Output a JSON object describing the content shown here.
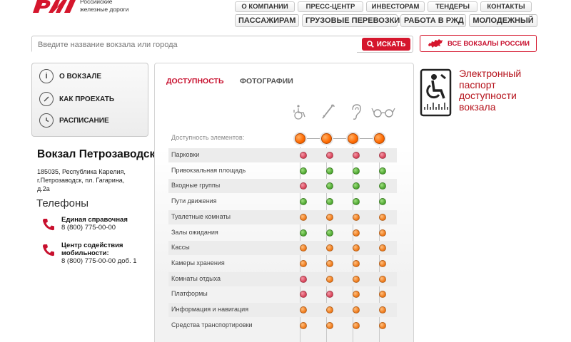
{
  "header": {
    "logo_text_line1": "Российские",
    "logo_text_line2": "железные дороги",
    "top_nav": [
      "О КОМПАНИИ",
      "ПРЕСС-ЦЕНТР",
      "ИНВЕСТОРАМ",
      "ТЕНДЕРЫ",
      "КОНТАКТЫ"
    ],
    "main_nav": [
      "ПАССАЖИРАМ",
      "ГРУЗОВЫЕ ПЕРЕВОЗКИ",
      "РАБОТА В РЖД",
      "МОЛОДЕЖНЫЙ"
    ]
  },
  "search": {
    "placeholder": "Введите название вокзала или города",
    "button_label": "ИСКАТЬ"
  },
  "all_stations_label": "ВСЕ ВОКЗАЛЫ РОССИИ",
  "side_menu": [
    {
      "label": "О ВОКЗАЛЕ",
      "icon": "info-icon"
    },
    {
      "label": "КАК ПРОЕХАТЬ",
      "icon": "compass-icon"
    },
    {
      "label": "РАСПИСАНИЕ",
      "icon": "clock-icon"
    }
  ],
  "station": {
    "title": "Вокзал Петрозаводск",
    "address_line1": "185035, Республика Карелия,",
    "address_line2": "г.Петрозаводск, пл. Гагарина,",
    "address_line3": "д.2а"
  },
  "phones": {
    "title": "Телефоны",
    "items": [
      {
        "name_line1": "Единая справочная",
        "name_line2": "",
        "number": "8 (800) 775-00-00"
      },
      {
        "name_line1": "Центр содействия",
        "name_line2": "мобильности:",
        "number": "8 (800) 775-00-00 доб. 1"
      }
    ]
  },
  "tabs": {
    "active": "ДОСТУПНОСТЬ",
    "inactive": "ФОТОГРАФИИ"
  },
  "categories": [
    "wheelchair-icon",
    "cane-icon",
    "ear-icon",
    "glasses-icon"
  ],
  "colors": {
    "brand_red": "#c8102e",
    "green": "#4fa832",
    "orange": "#f07a1a",
    "red": "#d9445a"
  },
  "availability_label": "Доступность элементов:",
  "rows": [
    {
      "label": "Парковки",
      "status": [
        "red",
        "red",
        "red",
        "red"
      ]
    },
    {
      "label": "Привокзальная площадь",
      "status": [
        "green",
        "green",
        "green",
        "green"
      ]
    },
    {
      "label": "Входные группы",
      "status": [
        "red",
        "green",
        "green",
        "green"
      ]
    },
    {
      "label": "Пути движения",
      "status": [
        "green",
        "green",
        "green",
        "green"
      ]
    },
    {
      "label": "Туалетные комнаты",
      "status": [
        "orange",
        "orange",
        "orange",
        "orange"
      ]
    },
    {
      "label": "Залы ожидания",
      "status": [
        "green",
        "green",
        "orange",
        "orange"
      ]
    },
    {
      "label": "Кассы",
      "status": [
        "orange",
        "orange",
        "orange",
        "orange"
      ]
    },
    {
      "label": "Камеры хранения",
      "status": [
        "orange",
        "orange",
        "orange",
        "orange"
      ]
    },
    {
      "label": "Комнаты отдыха",
      "status": [
        "red",
        "orange",
        "orange",
        "orange"
      ]
    },
    {
      "label": "Платформы",
      "status": [
        "red",
        "red",
        "orange",
        "orange"
      ]
    },
    {
      "label": "Информация и навигация",
      "status": [
        "orange",
        "orange",
        "orange",
        "orange"
      ]
    },
    {
      "label": "Средства транспортировки",
      "status": [
        "orange",
        "orange",
        "orange",
        "orange"
      ]
    }
  ],
  "passport": {
    "line1": "Электронный",
    "line2": "паспорт",
    "line3": "доступности",
    "line4": "вокзала"
  }
}
